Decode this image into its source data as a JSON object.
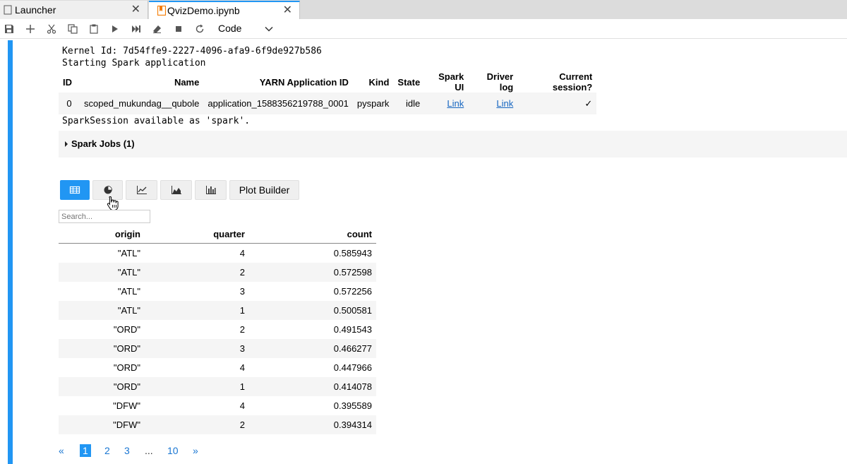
{
  "tabs": [
    {
      "label": "Launcher",
      "close": "✕"
    },
    {
      "label": "QvizDemo.ipynb",
      "close": "✕"
    }
  ],
  "toolbar": {
    "cell_type": "Code",
    "icons": [
      "save-icon",
      "add-icon",
      "cut-icon",
      "copy-icon",
      "paste-icon",
      "run-icon",
      "fast-forward-icon",
      "eraser-icon",
      "stop-icon",
      "restart-icon"
    ]
  },
  "output": {
    "kernel_line": "Kernel Id: 7d54ffe9-2227-4096-afa9-6f9de927b586",
    "starting_line": "Starting Spark application",
    "session_line": "SparkSession available as 'spark'.",
    "spark_table": {
      "headers": [
        "ID",
        "Name",
        "YARN Application ID",
        "Kind",
        "State",
        "Spark UI",
        "Driver log",
        "Current session?"
      ],
      "row": {
        "id": "0",
        "name": "scoped_mukundag__qubole",
        "app_id": "application_1588356219788_0001",
        "kind": "pyspark",
        "state": "idle",
        "spark_ui": "Link",
        "driver_log": "Link",
        "current": "✓"
      }
    },
    "spark_jobs": "Spark Jobs (1)"
  },
  "viz": {
    "buttons": [
      "table-icon",
      "pie-chart-icon",
      "line-chart-icon",
      "area-chart-icon",
      "bar-chart-icon"
    ],
    "plot_builder": "Plot Builder",
    "active": "table-icon"
  },
  "search": {
    "placeholder": "Search..."
  },
  "data_table": {
    "headers": [
      "origin",
      "quarter",
      "count"
    ],
    "rows": [
      [
        "\"ATL\"",
        "4",
        "0.585943"
      ],
      [
        "\"ATL\"",
        "2",
        "0.572598"
      ],
      [
        "\"ATL\"",
        "3",
        "0.572256"
      ],
      [
        "\"ATL\"",
        "1",
        "0.500581"
      ],
      [
        "\"ORD\"",
        "2",
        "0.491543"
      ],
      [
        "\"ORD\"",
        "3",
        "0.466277"
      ],
      [
        "\"ORD\"",
        "4",
        "0.447966"
      ],
      [
        "\"ORD\"",
        "1",
        "0.414078"
      ],
      [
        "\"DFW\"",
        "4",
        "0.395589"
      ],
      [
        "\"DFW\"",
        "2",
        "0.394314"
      ]
    ]
  },
  "pagination": {
    "prev": "«",
    "pages": [
      "1",
      "2",
      "3"
    ],
    "ellipsis": "...",
    "last": "10",
    "next": "»",
    "current": "1"
  },
  "colors": {
    "accent": "#2196f3",
    "link": "#1565c0"
  }
}
